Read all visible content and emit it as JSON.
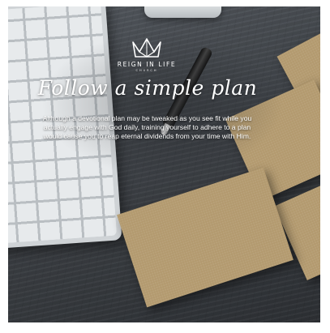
{
  "brand": {
    "name": "REIGN IN LIFE",
    "sub": "CHURCH",
    "logo_icon": "crown-icon"
  },
  "headline": "Follow a simple plan",
  "body": "Although a devotional plan may be tweaked as you see fit while you actually engage with God daily, training yourself to adhere to a plan would cause you to reap eternal dividends from your time with Him.",
  "colors": {
    "note": "#b39a6f",
    "wood": "#44484d",
    "text": "#ffffff"
  }
}
